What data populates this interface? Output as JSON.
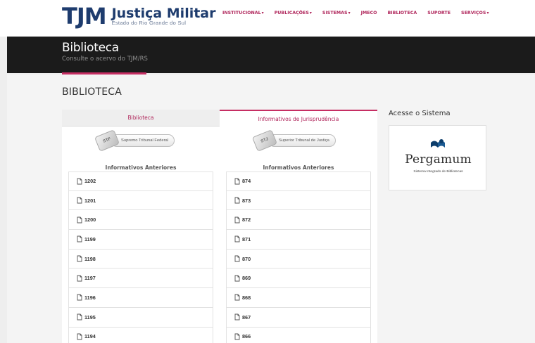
{
  "header": {
    "logo_mark": "TJM",
    "logo_title": "Justiça Militar",
    "logo_subtitle": "Estado do Rio Grande do Sul",
    "nav": [
      {
        "label": "INSTITUCIONAL",
        "dropdown": true
      },
      {
        "label": "PUBLICAÇÕES",
        "dropdown": true
      },
      {
        "label": "SISTEMAS",
        "dropdown": true
      },
      {
        "label": "JMECO",
        "dropdown": false
      },
      {
        "label": "BIBLIOTECA",
        "dropdown": false
      },
      {
        "label": "SUPORTE",
        "dropdown": false
      },
      {
        "label": "SERVIÇOS",
        "dropdown": true
      }
    ],
    "caret": "▾"
  },
  "banner": {
    "title": "Biblioteca",
    "subtitle": "Consulte o acervo do TJM/RS"
  },
  "page": {
    "heading": "BIBLIOTECA"
  },
  "tabs": [
    {
      "label": "Biblioteca",
      "active": false
    },
    {
      "label": "Informativos de Jurisprudência",
      "active": true
    }
  ],
  "columns": [
    {
      "court_abbrev": "STF",
      "court_name": "Supremo Tribunal Federal",
      "list_heading": "Informativos Anteriores",
      "items": [
        "1202",
        "1201",
        "1200",
        "1199",
        "1198",
        "1197",
        "1196",
        "1195",
        "1194"
      ]
    },
    {
      "court_abbrev": "STJ",
      "court_name": "Superior Tribunal de Justiça",
      "list_heading": "Informativos Anteriores",
      "items": [
        "874",
        "873",
        "872",
        "871",
        "870",
        "869",
        "868",
        "867",
        "866"
      ]
    }
  ],
  "sidebar": {
    "heading": "Acesse o Sistema",
    "pergamum_title": "Pergamum",
    "pergamum_subtitle": "Sistema Integrado de Bibliotecas"
  },
  "colors": {
    "accent": "#c62e63",
    "brand_blue": "#1e3c6e",
    "banner_bg": "#1b1b1b"
  },
  "icons": {
    "list_item": "document-icon",
    "pergamum": "pergamum-logo-icon"
  }
}
